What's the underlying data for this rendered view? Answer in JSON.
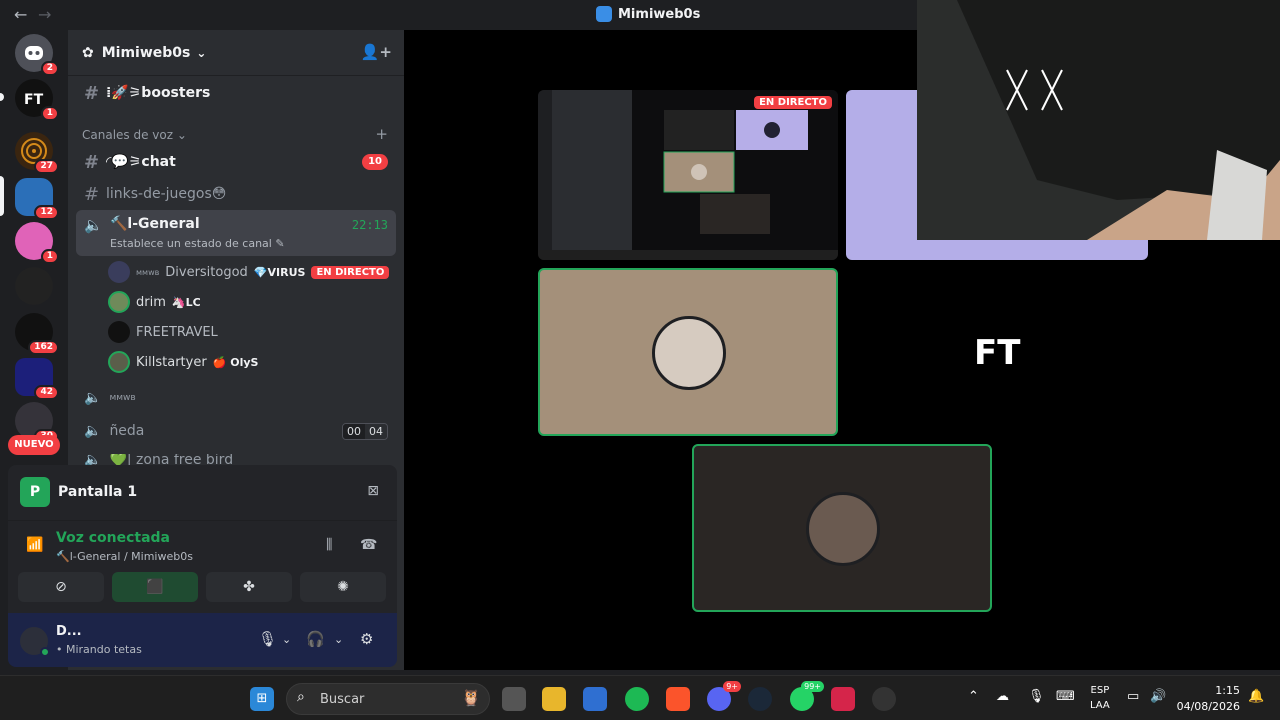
{
  "titlebar": {
    "back": "←",
    "forward": "→",
    "title": "Mimiweb0s"
  },
  "rail": {
    "servers": [
      {
        "name": "discord-home",
        "badge": "2",
        "color": "#4e5058"
      },
      {
        "name": "ft-server",
        "badge": "1",
        "color": "#111111"
      },
      {
        "name": "spiral-server",
        "badge": "27",
        "color": "#3a2510"
      },
      {
        "name": "game-server",
        "badge": "12",
        "color": "#2b6fb8"
      },
      {
        "name": "pink-server",
        "badge": "1",
        "color": "#e063b8"
      },
      {
        "name": "dark-server",
        "badge": "",
        "color": "#222222"
      },
      {
        "name": "text-server",
        "badge": "162",
        "color": "#111111"
      },
      {
        "name": "neon-server",
        "badge": "42",
        "color": "#1c1f7a"
      },
      {
        "name": "drop-server",
        "badge": "30",
        "color": "#35333a"
      }
    ],
    "nuevo": "NUEVO"
  },
  "server": {
    "name": "Mimiweb0s",
    "caret": "⌄"
  },
  "channels": {
    "boosters": "⁞🚀⚞boosters",
    "category": "Canales de voz",
    "chat": "◜💬⚞chat",
    "chat_count": "10",
    "links": "links-de-juegos😳",
    "active": {
      "name": "🔨l-General",
      "status": "Establece un estado de canal ✎",
      "time": "22:13"
    },
    "members": [
      {
        "prefix": "ᴍᴍᴡʙ",
        "name": "Diversitogod",
        "tag": "💎VIRUS",
        "live": "EN DIRECTO",
        "color": "#3a3d5c"
      },
      {
        "prefix": "",
        "name": "drim",
        "tag": "🦄LC",
        "live": "",
        "color": "#6f8a5a"
      },
      {
        "prefix": "",
        "name": "FREETRAVEL",
        "tag": "",
        "live": "",
        "color": "#111111"
      },
      {
        "prefix": "",
        "name": "Killstartyer",
        "tag": "🍎 OlyS",
        "live": "",
        "color": "#5a5e4a"
      }
    ],
    "mmwb": "ᴍᴍᴡʙ",
    "neda": "ñeda",
    "neda_counts": [
      "00",
      "04"
    ],
    "zona": "💚| zona free bird"
  },
  "screen": {
    "icon_letter": "P",
    "label": "Pantalla 1"
  },
  "voice": {
    "status": "Voz conectada",
    "where": "🔨l-General / Mimiweb0s"
  },
  "actions": [
    "⊘",
    "⬛",
    "✤",
    "✺"
  ],
  "user": {
    "name": "D...",
    "status": "• Mirando tetas"
  },
  "stage": {
    "live_badge": "EN DIRECTO"
  },
  "taskbar": {
    "search": "Buscar",
    "discord_badge": "9+",
    "whatsapp_badge": "99+",
    "lang_top": "ESP",
    "lang_bottom": "LAA",
    "time": "1:15",
    "date": "04/08/2026"
  }
}
